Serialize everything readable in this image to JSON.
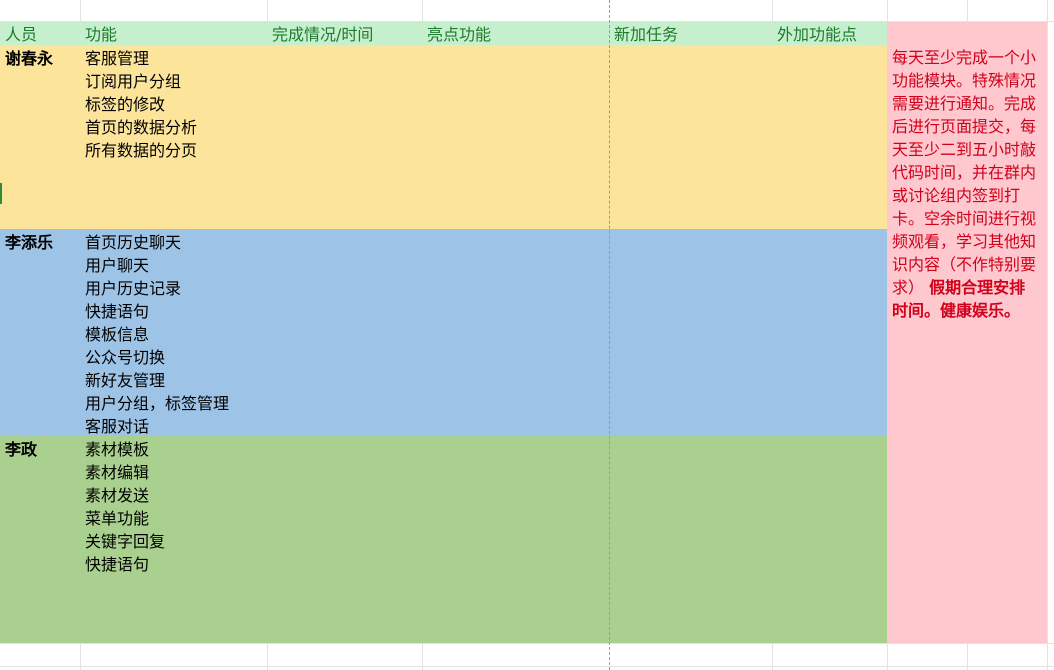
{
  "header": {
    "person": "人员",
    "function": "功能",
    "status_time": "完成情况/时间",
    "highlight": "亮点功能",
    "new_task": "新加任务",
    "extra_points": "外加功能点"
  },
  "rows": [
    {
      "person": "谢春永",
      "color": "#fde49b",
      "functions": [
        "客服管理",
        "订阅用户分组",
        "标签的修改",
        "首页的数据分析",
        "所有数据的分页"
      ]
    },
    {
      "person": "李添乐",
      "color": "#9dc3e6",
      "functions": [
        "首页历史聊天",
        "用户聊天",
        "用户历史记录",
        "快捷语句",
        "模板信息",
        "公众号切换",
        "新好友管理",
        "用户分组，标签管理",
        "客服对话"
      ]
    },
    {
      "person": "李政",
      "color": "#a9d08e",
      "functions": [
        "素材模板",
        "素材编辑",
        "素材发送",
        "菜单功能",
        "关键字回复",
        "快捷语句"
      ]
    }
  ],
  "note": {
    "text": "每天至少完成一个小功能模块。特殊情况需要进行通知。完成后进行页面提交，每天至少二到五小时敲代码时间，并在群内或讨论组内签到打卡。空余时间进行视频观看，学习其他知识内容（不作特别要求）",
    "strong": "假期合理安排时间。健康娱乐。",
    "color": "#ffc7ce",
    "text_color": "#d0021b"
  },
  "colors": {
    "header_bg": "#c6efce",
    "header_text": "#1f7a2e"
  }
}
